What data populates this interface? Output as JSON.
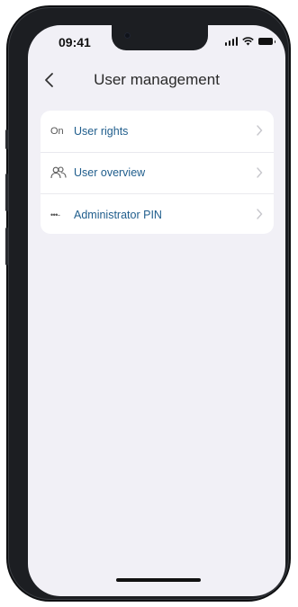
{
  "status_bar": {
    "time": "09:41"
  },
  "header": {
    "title": "User management"
  },
  "menu": {
    "items": [
      {
        "label": "User rights",
        "icon_text": "On",
        "icon": "on-toggle-icon"
      },
      {
        "label": "User overview",
        "icon": "users-icon"
      },
      {
        "label": "Administrator PIN",
        "icon": "pin-dots-icon",
        "icon_text": "•••-"
      }
    ]
  },
  "colors": {
    "accent": "#1f5d8c",
    "background": "#f1f0f6",
    "card": "#ffffff"
  }
}
